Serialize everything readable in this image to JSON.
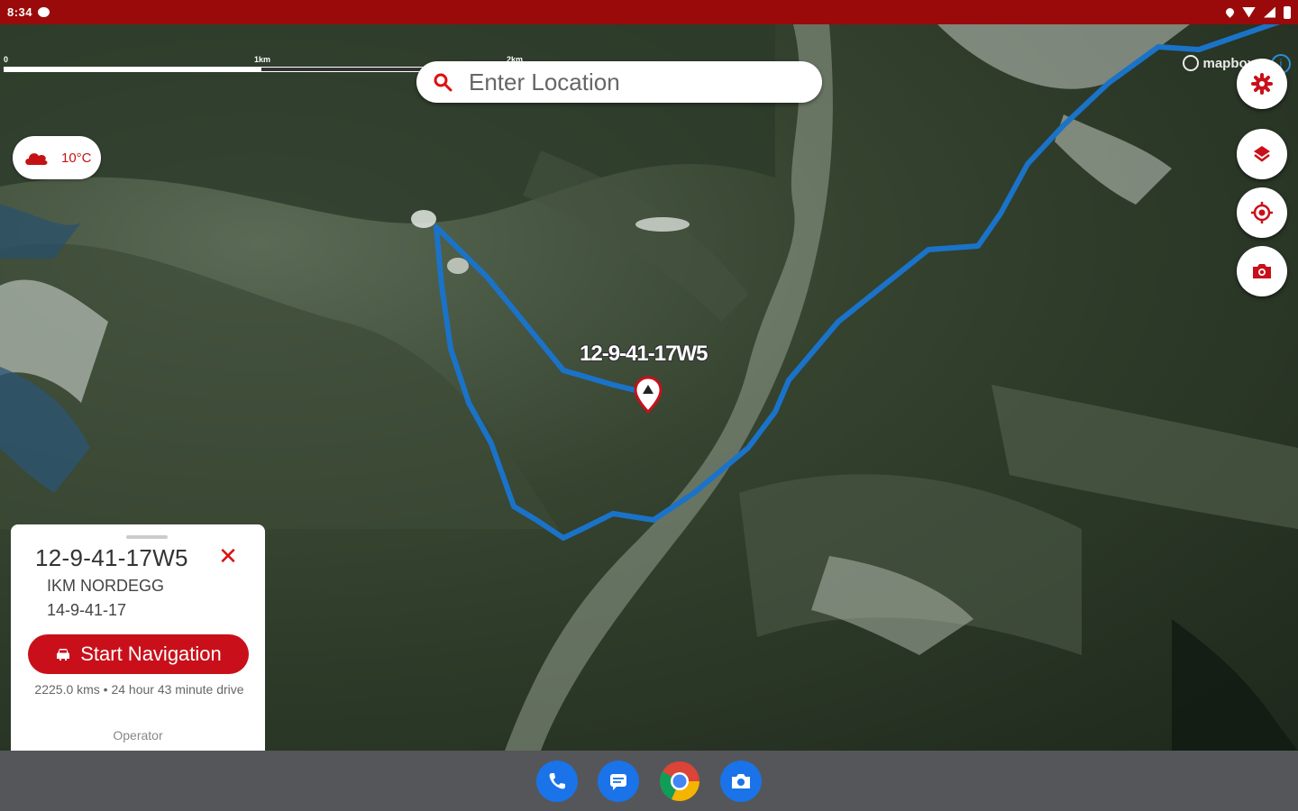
{
  "status_bar": {
    "time": "8:34",
    "icons": [
      "chat-icon",
      "location-icon",
      "wifi-icon",
      "signal-icon",
      "battery-icon"
    ]
  },
  "map": {
    "scale_labels": [
      "0",
      "1km",
      "2km"
    ],
    "attribution": "mapbox",
    "info_icon": "i",
    "route_color": "#1a73c8",
    "well_label": "12-9-41-17W5"
  },
  "search": {
    "placeholder": "Enter Location"
  },
  "weather": {
    "icon": "cloud-icon",
    "temperature": "10°C"
  },
  "fabs": [
    "settings-icon",
    "layers-icon",
    "my-location-icon",
    "camera-icon"
  ],
  "sheet": {
    "title": "12-9-41-17W5",
    "company": "IKM NORDEGG",
    "surface_location": "14-9-41-17",
    "nav_button": "Start Navigation",
    "distance": "2225.0 kms • 24 hour 43 minute drive",
    "operator_label": "Operator"
  },
  "dock": [
    "phone-icon",
    "messages-icon",
    "chrome-icon",
    "camera-app-icon"
  ],
  "colors": {
    "brand_red": "#9b0a0a",
    "button_red": "#c9101a",
    "route_blue": "#1a73c8"
  }
}
